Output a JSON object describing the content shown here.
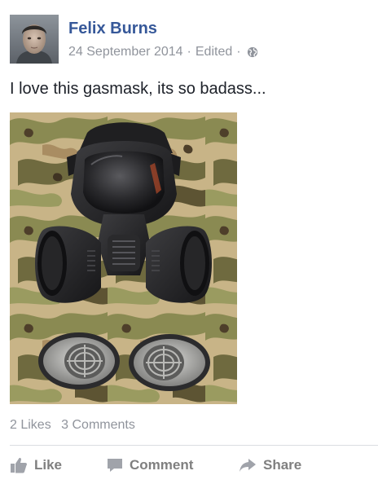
{
  "post": {
    "author": "Felix Burns",
    "date": "24 September 2014",
    "edited": "Edited",
    "separator": "·",
    "privacy_icon": "globe-icon",
    "text": "I love this gasmask, its so badass...",
    "photo_icon": "gas-mask-photo",
    "stats": {
      "likes": "2 Likes",
      "comments": "3 Comments"
    },
    "actions": {
      "like": "Like",
      "comment": "Comment",
      "share": "Share"
    }
  },
  "colors": {
    "author_link": "#365899",
    "meta_text": "#90949c",
    "action_text": "#7f7f7f",
    "divider": "#dadde1"
  }
}
